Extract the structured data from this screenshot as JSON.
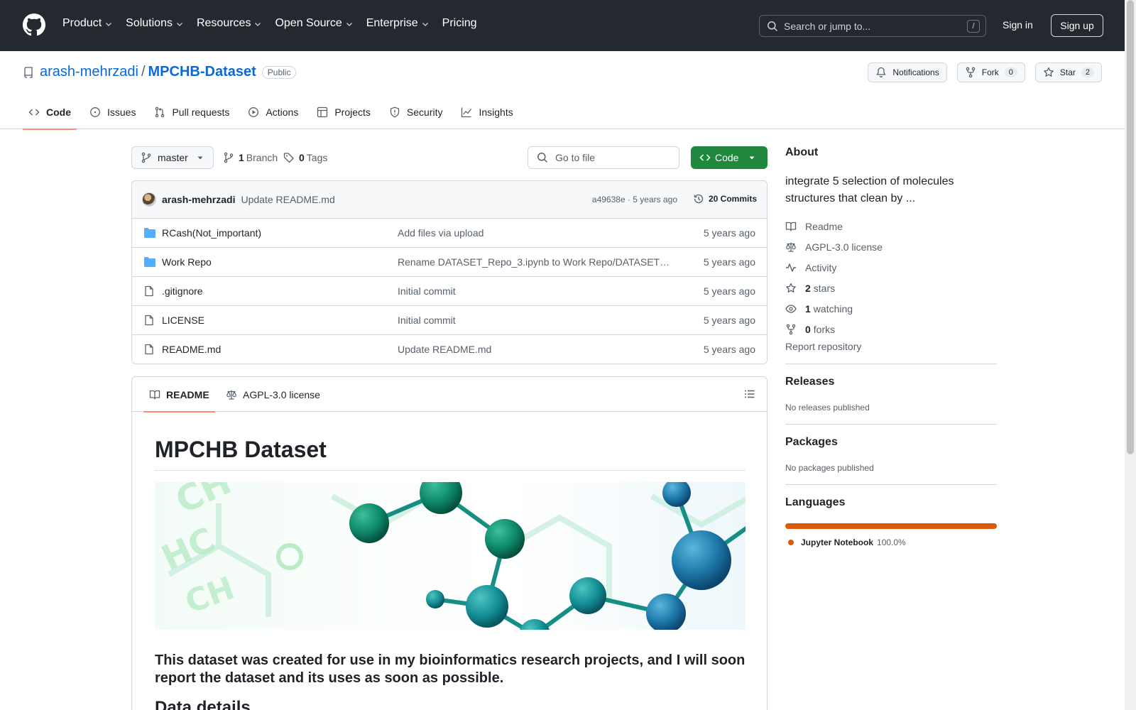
{
  "header": {
    "nav": [
      "Product",
      "Solutions",
      "Resources",
      "Open Source",
      "Enterprise",
      "Pricing"
    ],
    "search_placeholder": "Search or jump to...",
    "search_shortcut": "/",
    "sign_in": "Sign in",
    "sign_up": "Sign up"
  },
  "repo": {
    "owner": "arash-mehrzadi",
    "separator": "/",
    "name": "MPCHB-Dataset",
    "visibility": "Public",
    "notifications": "Notifications",
    "fork_label": "Fork",
    "fork_count": "0",
    "star_label": "Star",
    "star_count": "2",
    "tabs": [
      "Code",
      "Issues",
      "Pull requests",
      "Actions",
      "Projects",
      "Security",
      "Insights"
    ]
  },
  "toolbar": {
    "branch": "master",
    "branch_count": "1",
    "branch_label": "Branch",
    "tags_count": "0",
    "tags_label": "Tags",
    "goto_file": "Go to file",
    "code_button": "Code"
  },
  "commit": {
    "author": "arash-mehrzadi",
    "message": "Update README.md",
    "meta": "a49638e · 5 years ago",
    "commits": "20 Commits"
  },
  "files": [
    {
      "type": "folder",
      "name": "RCash(Not_important)",
      "message": "Add files via upload",
      "time": "5 years ago"
    },
    {
      "type": "folder",
      "name": "Work Repo",
      "message": "Rename DATASET_Repo_3.ipynb to Work Repo/DATASET_Repo_3.ipynb",
      "time": "5 years ago"
    },
    {
      "type": "file",
      "name": ".gitignore",
      "message": "Initial commit",
      "time": "5 years ago"
    },
    {
      "type": "file",
      "name": "LICENSE",
      "message": "Initial commit",
      "time": "5 years ago"
    },
    {
      "type": "file",
      "name": "README.md",
      "message": "Update README.md",
      "time": "5 years ago"
    }
  ],
  "readme": {
    "tab_readme": "README",
    "tab_license": "AGPL-3.0 license",
    "title": "MPCHB Dataset",
    "paragraph": "This dataset was created for use in my bioinformatics research projects, and I will soon report the dataset and its uses as soon as possible.",
    "heading2": "Data details"
  },
  "about": {
    "title": "About",
    "description": "integrate 5 selection of molecules structures that clean by ...",
    "readme": "Readme",
    "license": "AGPL-3.0 license",
    "activity": "Activity",
    "stars_count": "2",
    "stars_label": "stars",
    "watching_count": "1",
    "watching_label": "watching",
    "forks_count": "0",
    "forks_label": "forks",
    "report": "Report repository"
  },
  "releases": {
    "title": "Releases",
    "empty": "No releases published"
  },
  "packages": {
    "title": "Packages",
    "empty": "No packages published"
  },
  "languages": {
    "title": "Languages",
    "items": [
      {
        "name": "Jupyter Notebook",
        "percent": "100.0%",
        "share": 100,
        "color": "#da5b0b"
      }
    ]
  },
  "colors": {
    "header_bg": "#24292f",
    "link": "#0969da",
    "primary_button": "#1f883d",
    "tab_underline": "#fd8c73"
  }
}
